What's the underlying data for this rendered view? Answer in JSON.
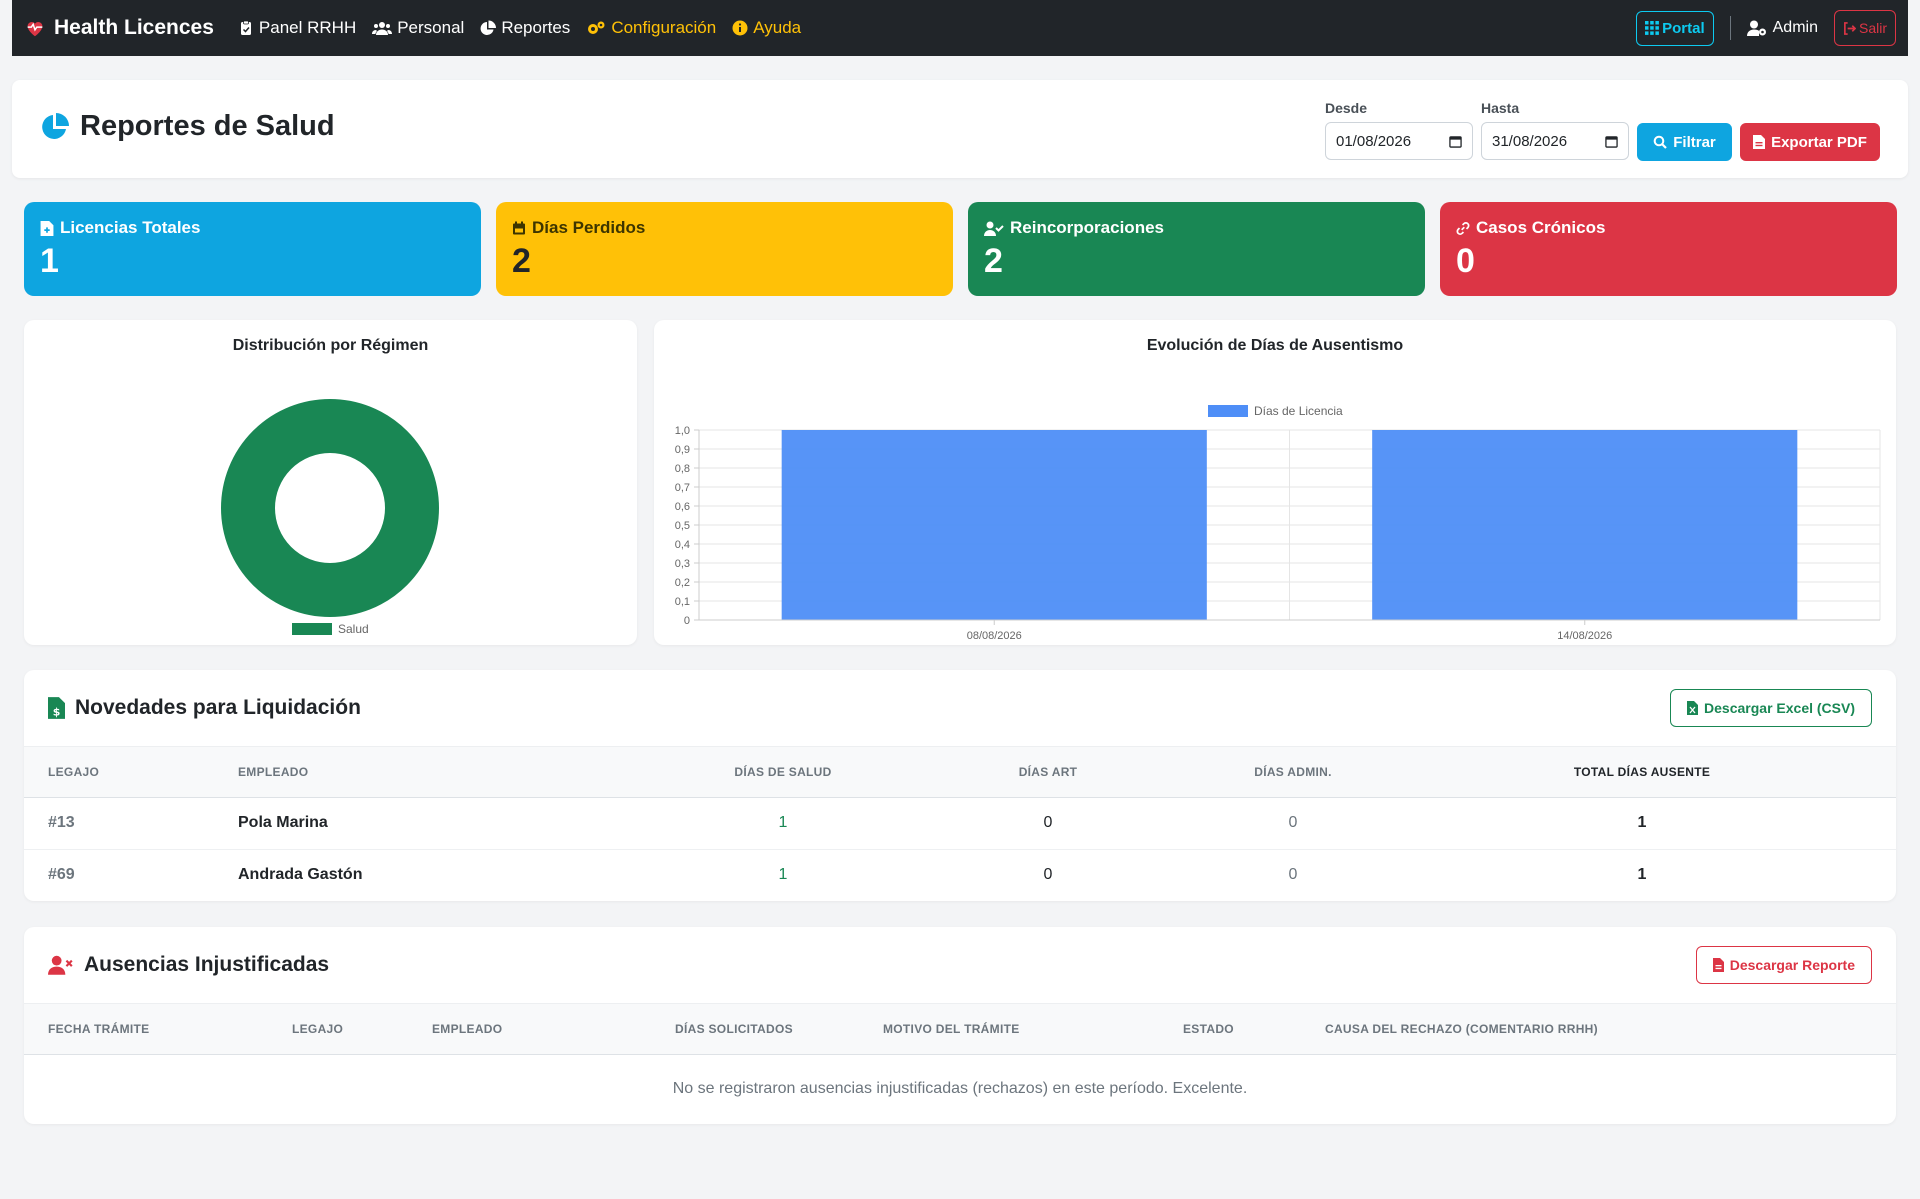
{
  "nav": {
    "brand": "Health Licences",
    "items": [
      {
        "label": "Panel RRHH",
        "icon": "clipboard-check-icon"
      },
      {
        "label": "Personal",
        "icon": "users-icon"
      },
      {
        "label": "Reportes",
        "icon": "chart-pie-icon"
      },
      {
        "label": "Configuración",
        "icon": "gears-icon"
      },
      {
        "label": "Ayuda",
        "icon": "info-circle-icon"
      }
    ],
    "portal": "Portal",
    "user": "Admin",
    "logout": "Salir"
  },
  "header": {
    "title": "Reportes de Salud",
    "desde_label": "Desde",
    "desde_value": "01/08/2026",
    "hasta_label": "Hasta",
    "hasta_value": "31/08/2026",
    "filter_button": "Filtrar",
    "export_button": "Exportar PDF"
  },
  "stats": [
    {
      "label": "Licencias Totales",
      "value": "1",
      "icon": "file-medical-icon",
      "color": "#0ea5e0"
    },
    {
      "label": "Días Perdidos",
      "value": "2",
      "icon": "calendar-icon",
      "color": "#ffc107"
    },
    {
      "label": "Reincorporaciones",
      "value": "2",
      "icon": "user-check-icon",
      "color": "#198754"
    },
    {
      "label": "Casos Crónicos",
      "value": "0",
      "icon": "link-icon",
      "color": "#dc3545"
    }
  ],
  "chart_data": [
    {
      "type": "pie",
      "title": "Distribución por Régimen",
      "categories": [
        "Salud"
      ],
      "values": [
        1
      ],
      "colors": [
        "#198754"
      ],
      "legend": "bottom"
    },
    {
      "type": "bar",
      "title": "Evolución de Días de Ausentismo",
      "categories": [
        "08/08/2026",
        "14/08/2026"
      ],
      "series": [
        {
          "name": "Días de Licencia",
          "values": [
            1,
            1
          ]
        }
      ],
      "colors": [
        "#4e8ef7"
      ],
      "ylim": [
        0,
        1
      ],
      "yticks": [
        "0",
        "0,1",
        "0,2",
        "0,3",
        "0,4",
        "0,5",
        "0,6",
        "0,7",
        "0,8",
        "0,9",
        "1,0"
      ],
      "grid": true,
      "legend": "top"
    }
  ],
  "novedades": {
    "title": "Novedades para Liquidación",
    "button": "Descargar Excel (CSV)",
    "columns": [
      "Legajo",
      "Empleado",
      "Días de Salud",
      "Días ART",
      "Días Admin.",
      "Total Días Ausente"
    ],
    "rows": [
      {
        "legajo": "#13",
        "empleado": "Pola Marina",
        "salud": "1",
        "art": "0",
        "admin": "0",
        "total": "1"
      },
      {
        "legajo": "#69",
        "empleado": "Andrada Gastón",
        "salud": "1",
        "art": "0",
        "admin": "0",
        "total": "1"
      }
    ]
  },
  "ausencias": {
    "title": "Ausencias Injustificadas",
    "button": "Descargar Reporte",
    "columns": [
      "Fecha Trámite",
      "Legajo",
      "Empleado",
      "Días Solicitados",
      "Motivo del Trámite",
      "Estado",
      "Causa del Rechazo (Comentario RRHH)"
    ],
    "empty": "No se registraron ausencias injustificadas (rechazos) en este período. Excelente."
  }
}
